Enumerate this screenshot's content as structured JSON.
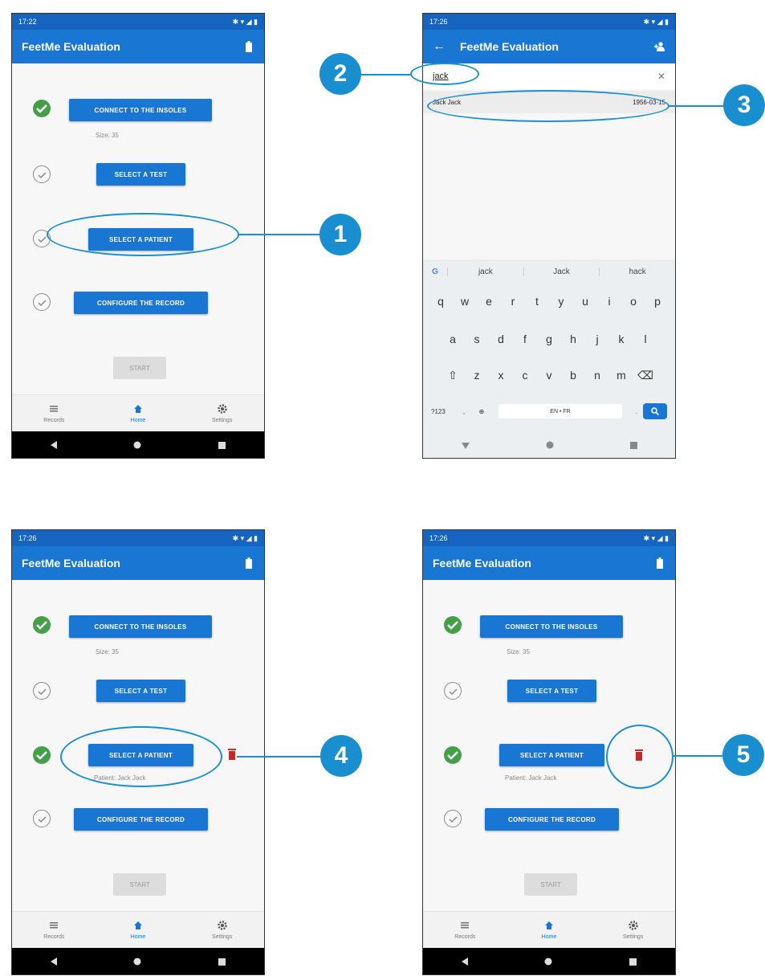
{
  "app": {
    "title": "FeetMe Evaluation",
    "accent": "#1976d2",
    "callout_color": "#1a8fd0",
    "done_color": "#43a047",
    "trash_color": "#c62828"
  },
  "screens": {
    "s1": {
      "time": "17:22",
      "steps": {
        "connect": "CONNECT TO THE INSOLES",
        "size": "Size: 35",
        "test": "SELECT A TEST",
        "patient": "SELECT A PATIENT",
        "configure": "CONFIGURE THE RECORD",
        "start": "START"
      }
    },
    "s2": {
      "time": "17:26",
      "query": "jack",
      "result_name": "Jack Jack",
      "result_date": "1956-03-15",
      "suggestions": [
        "jack",
        "Jack",
        "hack"
      ],
      "row1": [
        "q",
        "w",
        "e",
        "r",
        "t",
        "y",
        "u",
        "i",
        "o",
        "p"
      ],
      "row2": [
        "a",
        "s",
        "d",
        "f",
        "g",
        "h",
        "j",
        "k",
        "l"
      ],
      "row3": [
        "z",
        "x",
        "c",
        "v",
        "b",
        "n",
        "m"
      ],
      "sym_key": "?123",
      "lang_key": "EN • FR"
    },
    "s3": {
      "time": "17:26",
      "patient_label": "Patient: Jack Jack"
    },
    "s4": {
      "time": "17:26",
      "patient_label": "Patient: Jack Jack"
    }
  },
  "nav": {
    "records": "Records",
    "home": "Home",
    "settings": "Settings"
  },
  "callouts": [
    "1",
    "2",
    "3",
    "4",
    "5"
  ]
}
